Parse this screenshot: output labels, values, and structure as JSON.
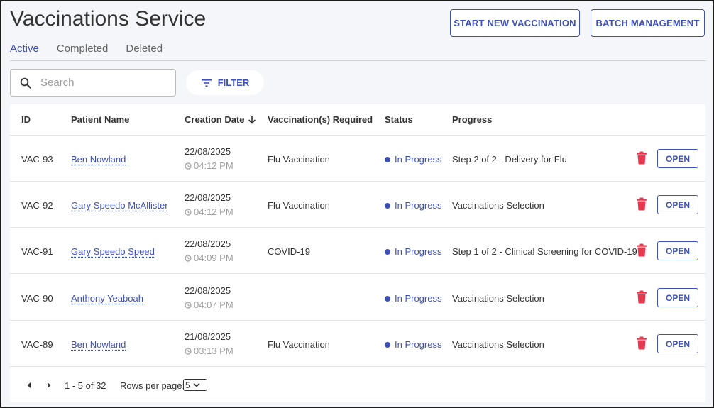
{
  "header": {
    "title": "Vaccinations Service",
    "start_label": "START NEW VACCINATION",
    "batch_label": "BATCH MANAGEMENT"
  },
  "tabs": [
    {
      "label": "Active",
      "active": true
    },
    {
      "label": "Completed",
      "active": false
    },
    {
      "label": "Deleted",
      "active": false
    }
  ],
  "search": {
    "placeholder": "Search",
    "value": ""
  },
  "filter": {
    "label": "FILTER"
  },
  "table": {
    "columns": {
      "id": "ID",
      "patient": "Patient Name",
      "date": "Creation Date",
      "vacc": "Vaccination(s) Required",
      "status": "Status",
      "progress": "Progress"
    },
    "sort_indicator": "arrow-down-icon",
    "rows": [
      {
        "id": "VAC-93",
        "patient": "Ben Nowland",
        "date": "22/08/2025",
        "time": "04:12 PM",
        "vacc": "Flu Vaccination",
        "status": "In Progress",
        "progress": "Step 2 of 2 - Delivery for Flu",
        "open": "OPEN"
      },
      {
        "id": "VAC-92",
        "patient": "Gary Speedo McAllister",
        "date": "22/08/2025",
        "time": "04:12 PM",
        "vacc": "Flu Vaccination",
        "status": "In Progress",
        "progress": "Vaccinations Selection",
        "open": "OPEN"
      },
      {
        "id": "VAC-91",
        "patient": "Gary Speedo Speed",
        "date": "22/08/2025",
        "time": "04:09 PM",
        "vacc": "COVID-19",
        "status": "In Progress",
        "progress": "Step 1 of 2 - Clinical Screening for COVID-19",
        "open": "OPEN"
      },
      {
        "id": "VAC-90",
        "patient": "Anthony Yeaboah",
        "date": "22/08/2025",
        "time": "04:07 PM",
        "vacc": "",
        "status": "In Progress",
        "progress": "Vaccinations Selection",
        "open": "OPEN"
      },
      {
        "id": "VAC-89",
        "patient": "Ben Nowland",
        "date": "21/08/2025",
        "time": "03:13 PM",
        "vacc": "Flu Vaccination",
        "status": "In Progress",
        "progress": "Vaccinations Selection",
        "open": "OPEN"
      }
    ]
  },
  "pagination": {
    "range": "1 - 5 of 32",
    "rows_label": "Rows per page:",
    "rows_value": "5"
  },
  "colors": {
    "accent": "#3f51b5",
    "danger": "#e53950",
    "background": "#f5f6fa"
  }
}
